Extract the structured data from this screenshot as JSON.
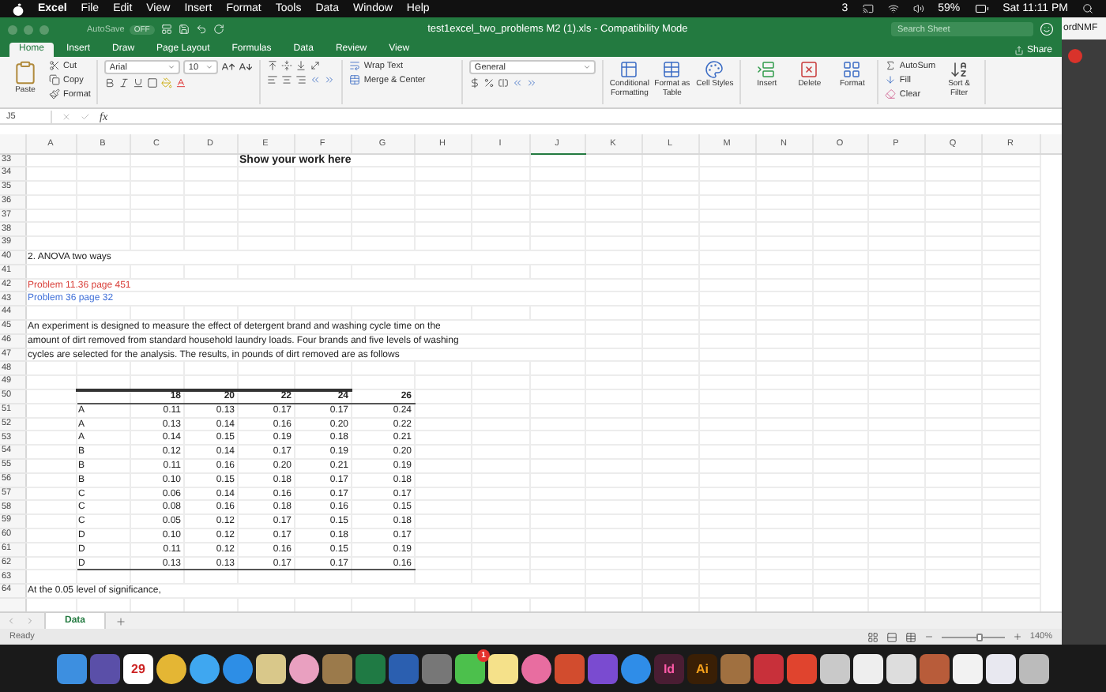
{
  "menu_bar": {
    "app": "Excel",
    "items": [
      "File",
      "Edit",
      "View",
      "Insert",
      "Format",
      "Tools",
      "Data",
      "Window",
      "Help"
    ],
    "notifications": "3",
    "battery": "59%",
    "clock": "Sat 11:11 PM"
  },
  "window": {
    "title": "test1excel_two_problems M2 (1).xls  -  Compatibility Mode",
    "autosave": {
      "label": "AutoSave",
      "state": "OFF",
      "on": false
    },
    "search": {
      "placeholder": "Search Sheet"
    }
  },
  "ribbon_tabs": [
    {
      "label": "Home",
      "selected": true
    },
    {
      "label": "Insert",
      "selected": false
    },
    {
      "label": "Draw",
      "selected": false
    },
    {
      "label": "Page Layout",
      "selected": false
    },
    {
      "label": "Formulas",
      "selected": false
    },
    {
      "label": "Data",
      "selected": false
    },
    {
      "label": "Review",
      "selected": false
    },
    {
      "label": "View",
      "selected": false
    }
  ],
  "share": "Share",
  "ribbon": {
    "paste": "Paste",
    "cut": "Cut",
    "copy": "Copy",
    "format_painter": "Format",
    "font": "Arial",
    "font_size": "10",
    "wrap_text": "Wrap Text",
    "merge": "Merge & Center",
    "number_format": "General",
    "styles": [
      {
        "kind": "conditional",
        "label": "Conditional Formatting"
      },
      {
        "kind": "table",
        "label": "Format as Table"
      },
      {
        "kind": "cell",
        "label": "Cell Styles"
      }
    ],
    "cells": [
      {
        "kind": "insert",
        "label": "Insert"
      },
      {
        "kind": "delete",
        "label": "Delete"
      },
      {
        "kind": "format",
        "label": "Format"
      }
    ],
    "autosum": "AutoSum",
    "fill": "Fill",
    "clear": "Clear",
    "sort": "Sort & Filter"
  },
  "formula_bar": {
    "name_box": "J5",
    "fx": "fx"
  },
  "sheet": {
    "columns": [
      {
        "label": "A",
        "selected": false
      },
      {
        "label": "B",
        "selected": false
      },
      {
        "label": "C",
        "selected": false
      },
      {
        "label": "D",
        "selected": false
      },
      {
        "label": "E",
        "selected": false
      },
      {
        "label": "F",
        "selected": false
      },
      {
        "label": "G",
        "selected": false
      },
      {
        "label": "H",
        "selected": false
      },
      {
        "label": "I",
        "selected": false
      },
      {
        "label": "J",
        "selected": true
      },
      {
        "label": "K",
        "selected": false
      },
      {
        "label": "L",
        "selected": false
      },
      {
        "label": "M",
        "selected": false
      },
      {
        "label": "N",
        "selected": false
      },
      {
        "label": "O",
        "selected": false
      },
      {
        "label": "P",
        "selected": false
      },
      {
        "label": "Q",
        "selected": false
      },
      {
        "label": "R",
        "selected": false
      }
    ],
    "rows": [
      {
        "number": "33",
        "kind": "title",
        "text": "Show your work here"
      },
      {
        "number": "34",
        "kind": "blank"
      },
      {
        "number": "35",
        "kind": "blank"
      },
      {
        "number": "36",
        "kind": "blank"
      },
      {
        "number": "37",
        "kind": "blank"
      },
      {
        "number": "38",
        "kind": "blank"
      },
      {
        "number": "39",
        "kind": "blank"
      },
      {
        "number": "40",
        "kind": "text",
        "text": "2. ANOVA two ways",
        "color": "#222222"
      },
      {
        "number": "41",
        "kind": "blank"
      },
      {
        "number": "42",
        "kind": "text",
        "text": "Problem 11.36 page 451",
        "color": "#d9413b"
      },
      {
        "number": "43",
        "kind": "text",
        "text": "Problem 36 page 32",
        "color": "#3f6fd8"
      },
      {
        "number": "44",
        "kind": "blank"
      },
      {
        "number": "45",
        "kind": "text",
        "text": "An experiment is designed to measure the effect of detergent brand and washing cycle time on the",
        "color": "#222222"
      },
      {
        "number": "46",
        "kind": "text",
        "text": "amount of dirt removed from standard household laundry loads. Four brands and five levels of washing",
        "color": "#222222"
      },
      {
        "number": "47",
        "kind": "text",
        "text": "cycles are selected for the analysis. The results, in pounds of dirt removed are as follows",
        "color": "#222222"
      },
      {
        "number": "48",
        "kind": "blank"
      },
      {
        "number": "49",
        "kind": "blank"
      },
      {
        "number": "50",
        "kind": "header",
        "cells": [
          "18",
          "20",
          "22",
          "24",
          "26"
        ]
      },
      {
        "number": "51",
        "kind": "data",
        "label": "A",
        "cells": [
          "0.11",
          "0.13",
          "0.17",
          "0.17",
          "0.24"
        ]
      },
      {
        "number": "52",
        "kind": "data",
        "label": "A",
        "cells": [
          "0.13",
          "0.14",
          "0.16",
          "0.20",
          "0.22"
        ]
      },
      {
        "number": "53",
        "kind": "data",
        "label": "A",
        "cells": [
          "0.14",
          "0.15",
          "0.19",
          "0.18",
          "0.21"
        ]
      },
      {
        "number": "54",
        "kind": "data",
        "label": "B",
        "cells": [
          "0.12",
          "0.14",
          "0.17",
          "0.19",
          "0.20"
        ]
      },
      {
        "number": "55",
        "kind": "data",
        "label": "B",
        "cells": [
          "0.11",
          "0.16",
          "0.20",
          "0.21",
          "0.19"
        ]
      },
      {
        "number": "56",
        "kind": "data",
        "label": "B",
        "cells": [
          "0.10",
          "0.15",
          "0.18",
          "0.17",
          "0.18"
        ]
      },
      {
        "number": "57",
        "kind": "data",
        "label": "C",
        "cells": [
          "0.06",
          "0.14",
          "0.16",
          "0.17",
          "0.17"
        ]
      },
      {
        "number": "58",
        "kind": "data",
        "label": "C",
        "cells": [
          "0.08",
          "0.16",
          "0.18",
          "0.16",
          "0.15"
        ]
      },
      {
        "number": "59",
        "kind": "data",
        "label": "C",
        "cells": [
          "0.05",
          "0.12",
          "0.17",
          "0.15",
          "0.18"
        ]
      },
      {
        "number": "60",
        "kind": "data",
        "label": "D",
        "cells": [
          "0.10",
          "0.12",
          "0.17",
          "0.18",
          "0.17"
        ]
      },
      {
        "number": "61",
        "kind": "data",
        "label": "D",
        "cells": [
          "0.11",
          "0.12",
          "0.16",
          "0.15",
          "0.19"
        ]
      },
      {
        "number": "62",
        "kind": "data",
        "label": "D",
        "cells": [
          "0.13",
          "0.13",
          "0.17",
          "0.17",
          "0.16"
        ]
      },
      {
        "number": "63",
        "kind": "blank"
      },
      {
        "number": "64",
        "kind": "text",
        "text": "At the 0.05 level of significance,",
        "color": "#222222"
      }
    ]
  },
  "sheet_tabs": [
    {
      "label": "Data",
      "selected": true
    }
  ],
  "status_bar": {
    "status": "Ready",
    "zoom": {
      "label": "140%",
      "level": 0.6
    }
  },
  "background_window": {
    "text": "ordNMF"
  },
  "dock": [
    {
      "kind": "app",
      "color": "#3d8fe0"
    },
    {
      "kind": "app",
      "color": "#5a4fa8"
    },
    {
      "kind": "calendar",
      "color": "#ffffff",
      "label": "29"
    },
    {
      "kind": "round",
      "color": "#e4b634"
    },
    {
      "kind": "round",
      "color": "#3fa7f0"
    },
    {
      "kind": "round",
      "color": "#2d8ee6"
    },
    {
      "kind": "app",
      "color": "#d9c88a"
    },
    {
      "kind": "round",
      "color": "#e9a0c0"
    },
    {
      "kind": "app",
      "color": "#9b7a4b"
    },
    {
      "kind": "app",
      "color": "#1f7a44"
    },
    {
      "kind": "app",
      "color": "#2b5fb0"
    },
    {
      "kind": "app",
      "color": "#777777"
    },
    {
      "kind": "badge",
      "color": "#4cc04c",
      "label": "1"
    },
    {
      "kind": "app",
      "color": "#f5e18a"
    },
    {
      "kind": "round",
      "color": "#e86da0"
    },
    {
      "kind": "app",
      "color": "#d24c2e"
    },
    {
      "kind": "app",
      "color": "#7a4bd0"
    },
    {
      "kind": "round",
      "color": "#2f8de8"
    },
    {
      "kind": "text",
      "color": "#4a1d33",
      "label": "Id"
    },
    {
      "kind": "text",
      "color": "#3a1f05",
      "label": "Ai"
    },
    {
      "kind": "app",
      "color": "#a07040"
    },
    {
      "kind": "app",
      "color": "#c8303a"
    },
    {
      "kind": "app",
      "color": "#e0442e"
    },
    {
      "kind": "app",
      "color": "#c9c9c9"
    },
    {
      "kind": "app",
      "color": "#eeeeee"
    },
    {
      "kind": "app",
      "color": "#dddddd"
    },
    {
      "kind": "app",
      "color": "#b85c3a"
    },
    {
      "kind": "app",
      "color": "#f2f2f2"
    },
    {
      "kind": "app",
      "color": "#e8e8f0"
    },
    {
      "kind": "app",
      "color": "#bbbbbb"
    }
  ]
}
